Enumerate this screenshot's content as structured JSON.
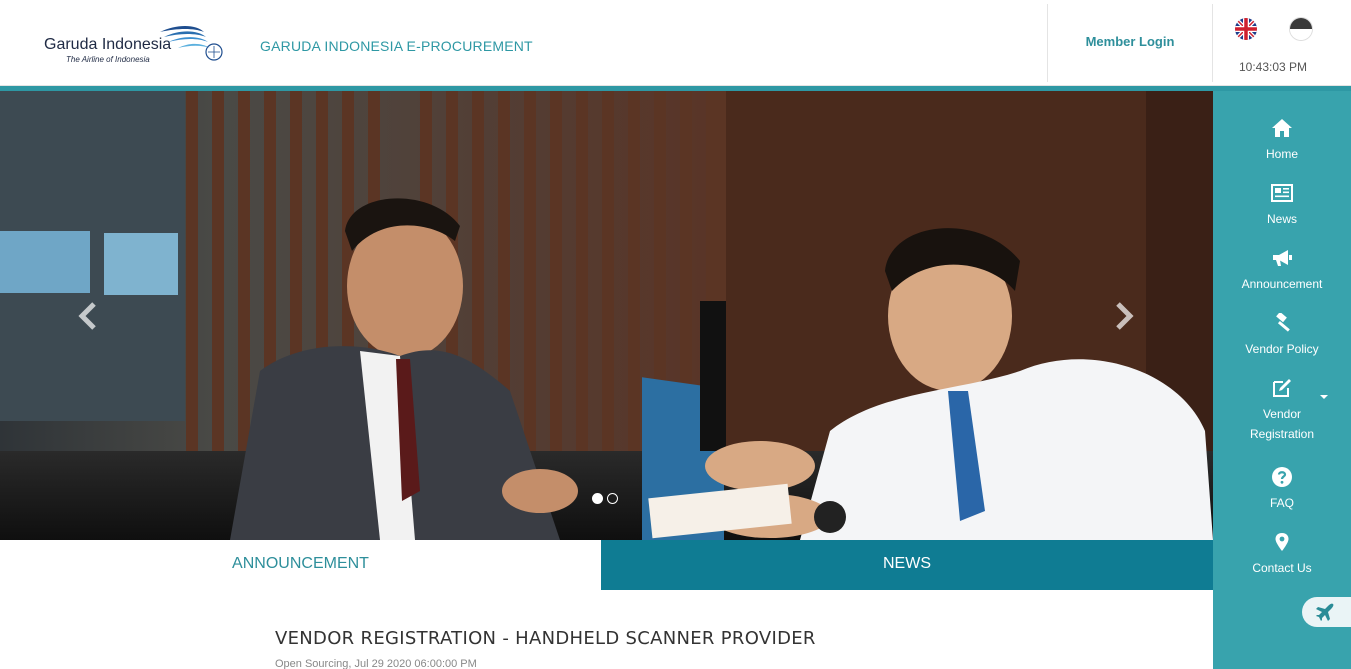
{
  "header": {
    "logo_name": "Garuda Indonesia",
    "logo_tagline": "The Airline of Indonesia",
    "site_title": "GARUDA INDONESIA E-PROCUREMENT",
    "member_login": "Member Login",
    "clock": "10:43:03 PM",
    "languages": [
      "en-flag-icon",
      "id-flag-icon"
    ],
    "accent_color": "#2e98a4"
  },
  "carousel": {
    "slides": 2,
    "active_slide": 1,
    "prev_icon": "chevron-left-icon",
    "next_icon": "chevron-right-icon"
  },
  "sidebar": {
    "background": "#38a3ad",
    "items": [
      {
        "label": "Home",
        "icon": "home-icon"
      },
      {
        "label": "News",
        "icon": "newspaper-icon"
      },
      {
        "label": "Announcement",
        "icon": "megaphone-icon"
      },
      {
        "label": "Vendor Policy",
        "icon": "gavel-icon"
      },
      {
        "label_line1": "Vendor",
        "label_line2": "Registration",
        "icon": "edit-icon"
      },
      {
        "label": "FAQ",
        "icon": "question-icon"
      },
      {
        "label": "Contact Us",
        "icon": "map-marker-icon"
      }
    ],
    "float_icon": "plane-icon"
  },
  "tabs": {
    "announcement": "ANNOUNCEMENT",
    "news": "NEWS",
    "active": "news"
  },
  "content": {
    "title": "VENDOR REGISTRATION - HANDHELD SCANNER PROVIDER",
    "meta": "Open Sourcing, Jul 29 2020 06:00:00 PM"
  }
}
